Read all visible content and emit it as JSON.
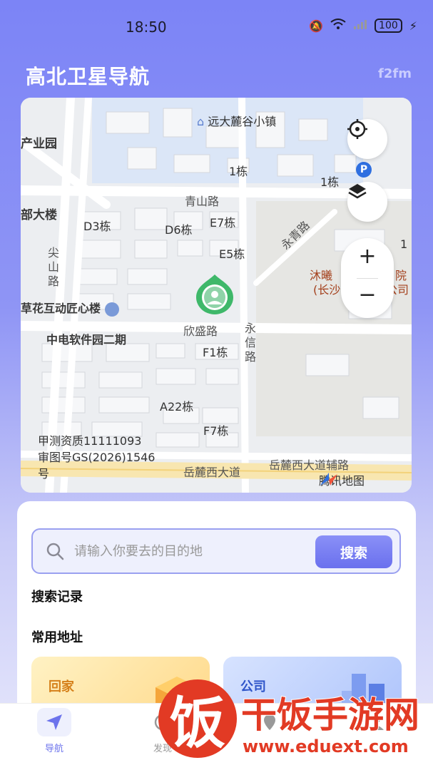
{
  "status_bar": {
    "time": "18:50",
    "battery": "100"
  },
  "header": {
    "title": "高北卫星导航",
    "badge": "f2fm"
  },
  "map": {
    "labels": {
      "town": "远大麓谷小镇",
      "park": "产业园",
      "b1a": "1栋",
      "b1b": "1栋",
      "qingshan": "青山路",
      "hq": "部大楼",
      "d3": "D3栋",
      "d6": "D6栋",
      "e7": "E7栋",
      "e5": "E5栋",
      "yongqing": "永青路",
      "jianshan": "尖山路",
      "muxi1": "沐曦",
      "muxi2": "院",
      "changsha": "(长沙",
      "company_suffix": "公司",
      "huahu": "草花互动匠心楼",
      "zhongdian": "中电软件园二期",
      "xinsheng": "欣盛路",
      "yongxin": "永信路",
      "f1": "F1栋",
      "a22": "A22栋",
      "f7": "F7栋",
      "license1": "甲测资质11111093",
      "license2": "审图号GS(2026)1546",
      "license3": "号",
      "yuelu": "岳麓西大道",
      "yuelu_aux": "岳麓西大道辅路",
      "provider": "腾讯地图",
      "side_partial": "1"
    },
    "zoom_in": "+",
    "zoom_out": "−"
  },
  "search": {
    "placeholder": "请输入你要去的目的地",
    "button": "搜索"
  },
  "sections": {
    "history": "搜索记录",
    "common": "常用地址"
  },
  "cards": {
    "home": "回家",
    "company": "公司"
  },
  "tabs": [
    {
      "label": "导航"
    },
    {
      "label": "发现"
    },
    {
      "label": ""
    },
    {
      "label": ""
    }
  ],
  "watermark": {
    "char": "饭",
    "name": "干饭手游网",
    "url": "www.eduext.com"
  }
}
